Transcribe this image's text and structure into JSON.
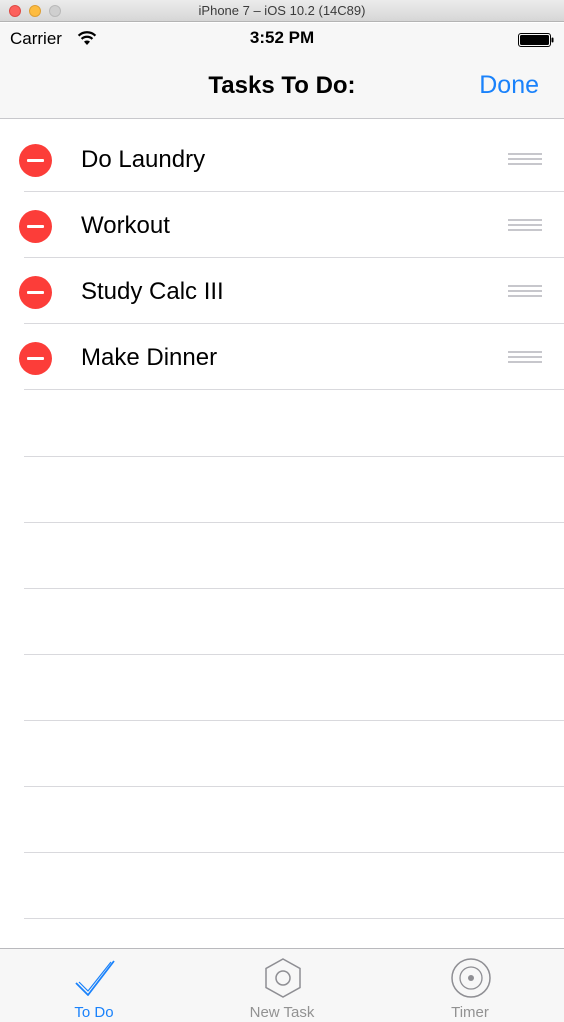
{
  "window": {
    "title": "iPhone 7 – iOS 10.2 (14C89)"
  },
  "status": {
    "carrier": "Carrier",
    "time": "3:52 PM",
    "wifi_icon": "wifi-icon",
    "battery_icon": "battery-icon"
  },
  "nav": {
    "title": "Tasks To Do:",
    "done_label": "Done"
  },
  "tasks": [
    {
      "label": "Do Laundry"
    },
    {
      "label": "Workout"
    },
    {
      "label": "Study Calc III"
    },
    {
      "label": "Make Dinner"
    }
  ],
  "tabs": [
    {
      "label": "To Do",
      "icon": "checkmark-icon",
      "active": true
    },
    {
      "label": "New Task",
      "icon": "hexagon-icon",
      "active": false
    },
    {
      "label": "Timer",
      "icon": "timer-icon",
      "active": false
    }
  ],
  "colors": {
    "accent": "#1a82fb",
    "delete": "#fc3d39",
    "inactive": "#929292"
  }
}
